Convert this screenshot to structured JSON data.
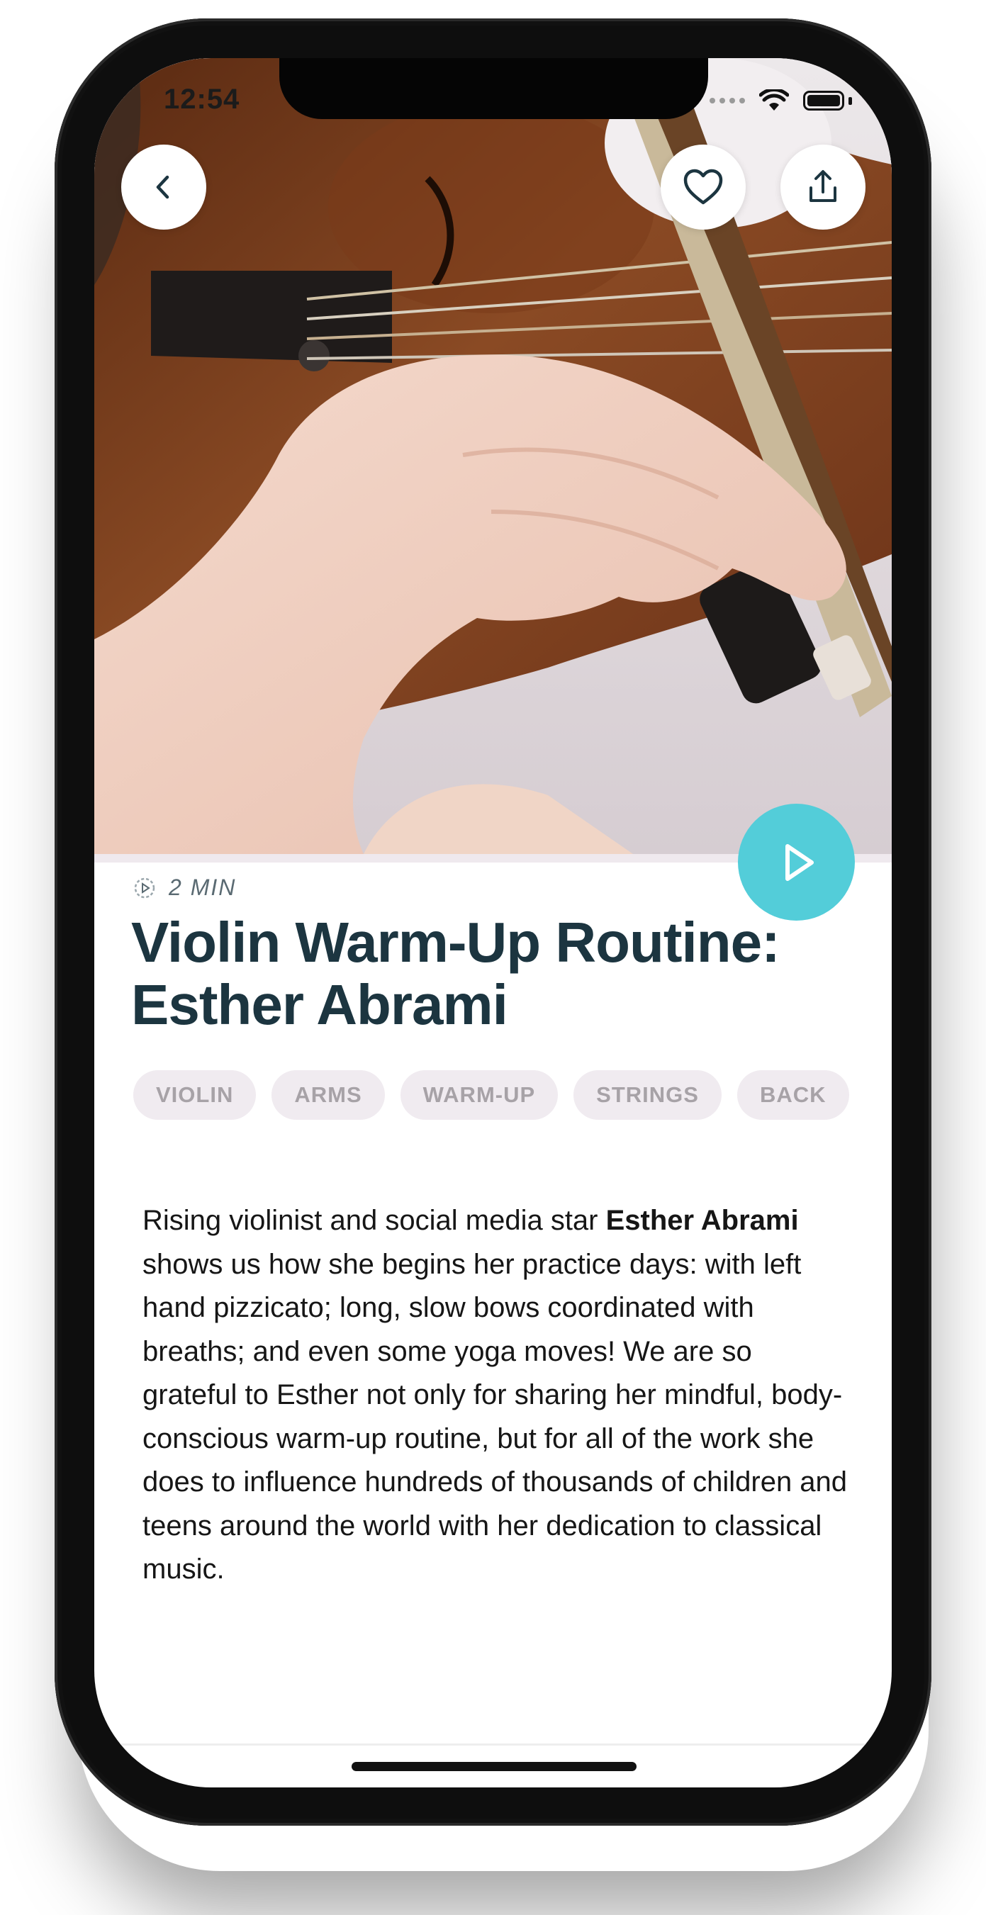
{
  "status_bar": {
    "time": "12:54"
  },
  "toolbar": {
    "back_icon": "chevron-left-icon",
    "favorite_icon": "heart-icon",
    "share_icon": "share-icon"
  },
  "player": {
    "play_icon": "play-icon",
    "accent_color": "#53cdd9"
  },
  "lesson": {
    "duration": "2 MIN",
    "title": "Violin Warm-Up Routine: Esther Abrami",
    "tags": [
      "VIOLIN",
      "ARMS",
      "WARM-UP",
      "STRINGS",
      "BACK"
    ],
    "description": {
      "intro": "Rising violinist and social media star ",
      "name": "Esther Abrami",
      "body": " shows us how she begins her practice days: with left hand pizzicato; long, slow bows coordinated with breaths; and even some yoga moves! We are so grateful to Esther not only for sharing her mindful, body-conscious warm-up routine, but for all of the work she does to influence hundreds of thousands of children and teens around the world with her dedication to classical music."
    }
  }
}
